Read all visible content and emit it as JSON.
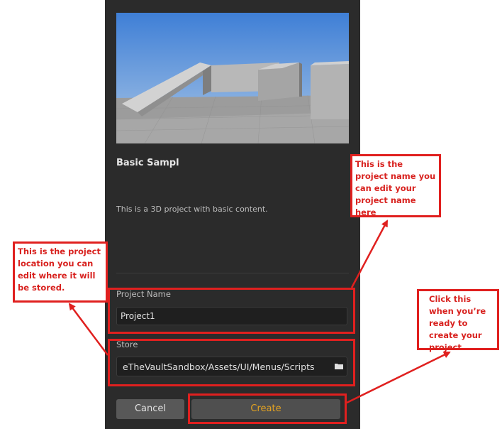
{
  "dialog": {
    "template_title": "Basic Sampl",
    "template_description": "This is a 3D project with basic content.",
    "project_name_label": "Project Name",
    "project_name_value": "Project1",
    "store_label": "Store",
    "store_path": "eTheVaultSandbox/Assets/UI/Menus/Scripts",
    "folder_icon": "folder-icon",
    "cancel_label": "Cancel",
    "create_label": "Create",
    "accent_color": "#e4a321"
  },
  "annotations": {
    "name_note": "This is the project name you can edit your project name here",
    "location_note": "This is the project location you can edit where it will be stored.",
    "create_note": "Click this when you’re ready to create your project",
    "highlight_color": "#e0201f"
  }
}
